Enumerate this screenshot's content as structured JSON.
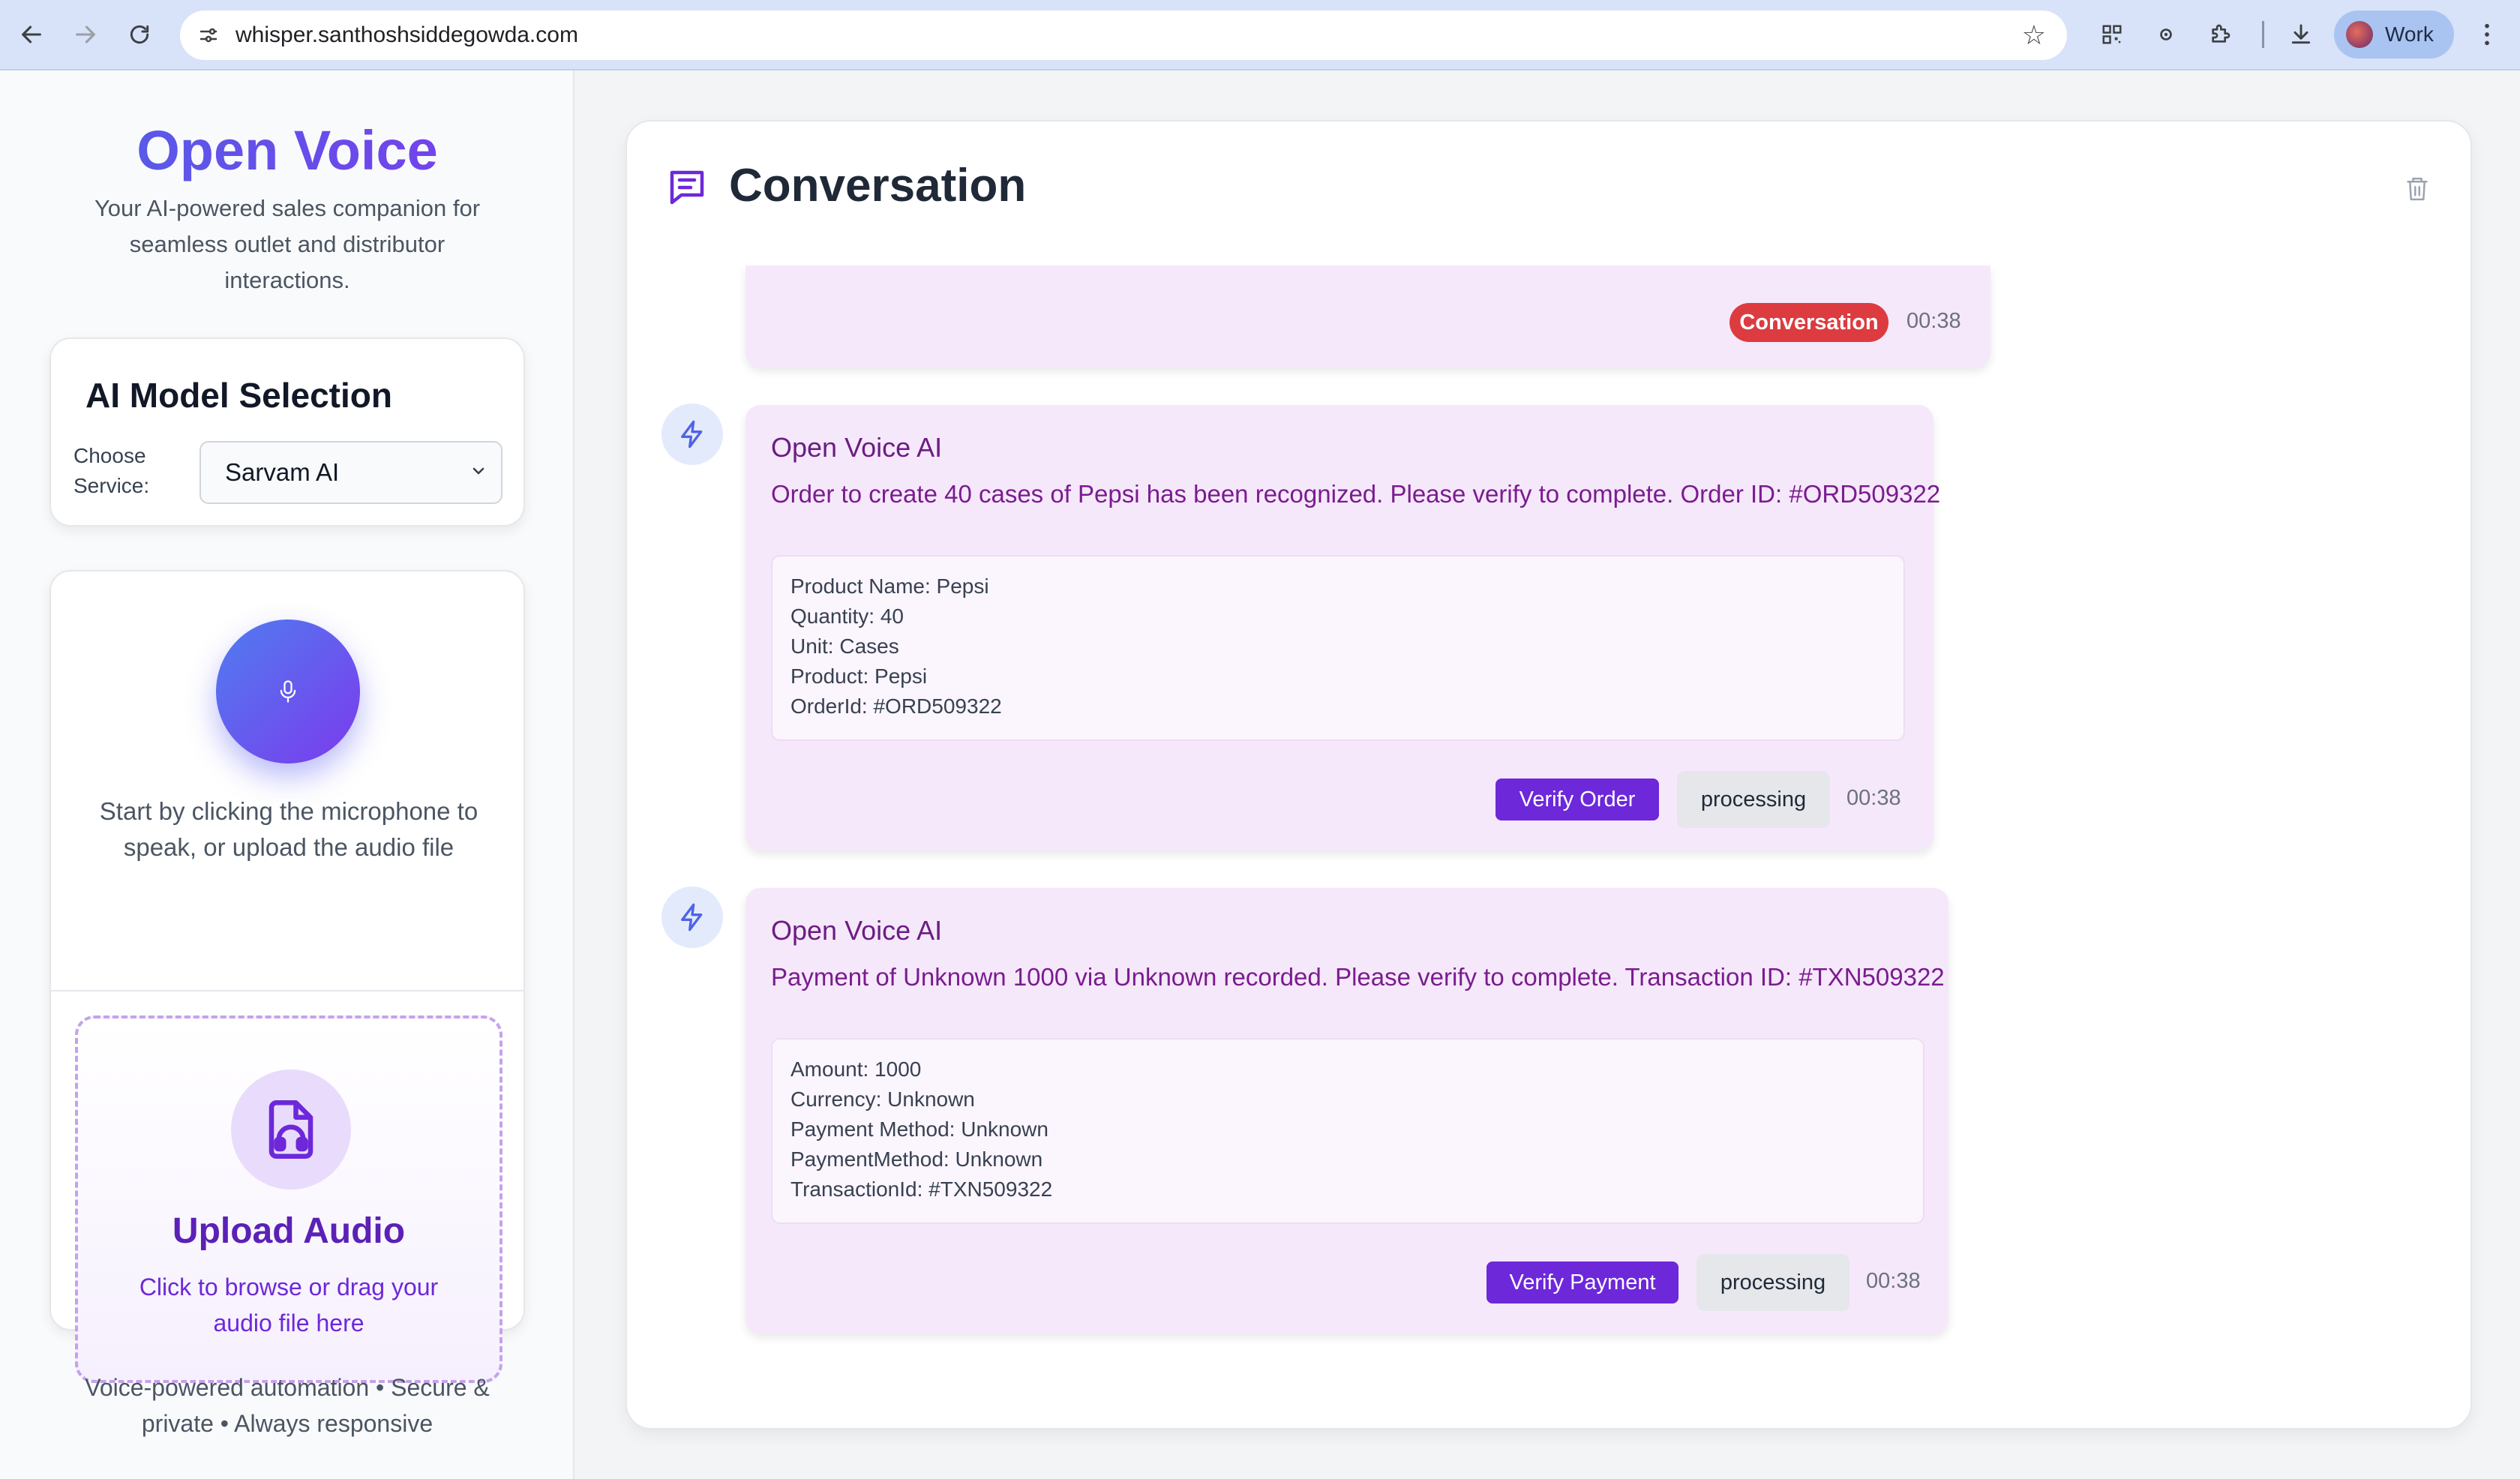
{
  "browser": {
    "url": "whisper.santhoshsiddegowda.com",
    "profile_label": "Work"
  },
  "sidebar": {
    "brand": "Open Voice",
    "tagline": "Your AI-powered sales companion for seamless outlet and distributor interactions.",
    "model_card": {
      "title": "AI Model Selection",
      "choose_label": "Choose Service:",
      "selected_service": "Sarvam AI"
    },
    "voice": {
      "hint": "Start by clicking the microphone to speak, or upload the audio file"
    },
    "upload": {
      "title": "Upload Audio",
      "hint": "Click to browse or drag your audio file here"
    },
    "footer": "Voice-powered automation • Secure & private • Always responsive"
  },
  "conversation": {
    "title": "Conversation",
    "top_message": {
      "badge": "Conversation",
      "time": "00:38",
      "badge_color": "#dc3b40"
    },
    "messages": [
      {
        "sender": "Open Voice AI",
        "text": "Order to create 40 cases of Pepsi has been recognized. Please verify to complete. Order ID: #ORD509322",
        "details": [
          "Product Name: Pepsi",
          "Quantity: 40",
          "Unit: Cases",
          "Product: Pepsi",
          "OrderId: #ORD509322"
        ],
        "action_label": "Verify Order",
        "status": "processing",
        "time": "00:38"
      },
      {
        "sender": "Open Voice AI",
        "text": "Payment of Unknown 1000 via Unknown recorded. Please verify to complete. Transaction ID: #TXN509322",
        "details": [
          "Amount: 1000",
          "Currency: Unknown",
          "Payment Method: Unknown",
          "PaymentMethod: Unknown",
          "TransactionId: #TXN509322"
        ],
        "action_label": "Verify Payment",
        "status": "processing",
        "time": "00:38"
      }
    ]
  },
  "colors": {
    "accent": "#6d28d9",
    "message_bg": "#f6e8fb",
    "brand_gradient_start": "#4f63e7",
    "brand_gradient_end": "#7c3aed"
  }
}
